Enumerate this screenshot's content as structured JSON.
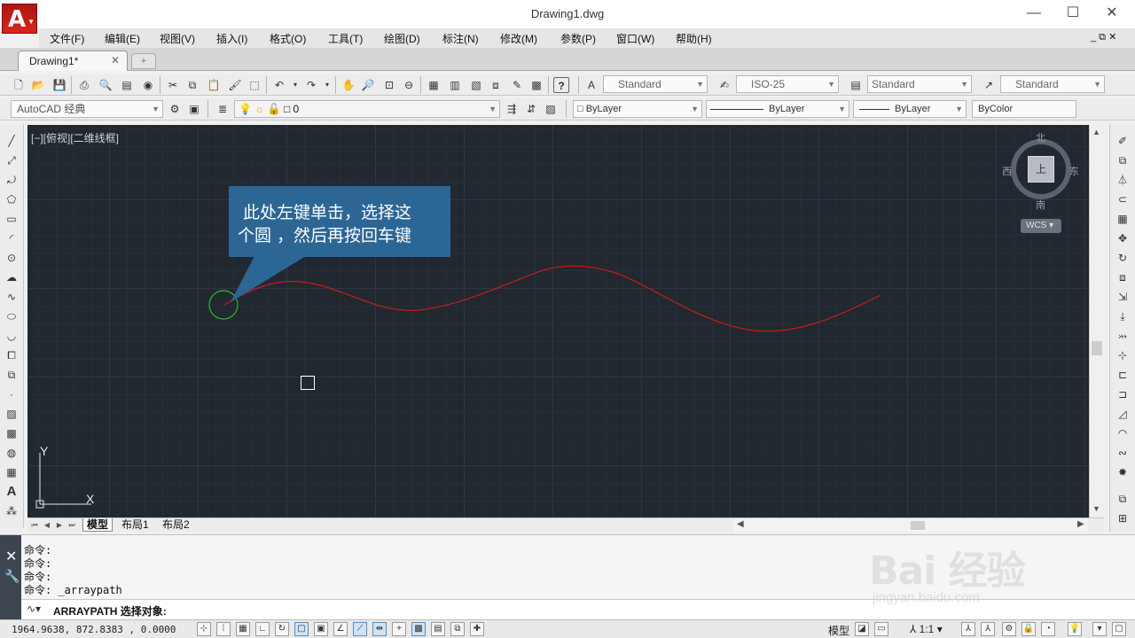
{
  "window": {
    "title": "Drawing1.dwg",
    "logo_letter": "A",
    "minimize": "—",
    "maximize": "☐",
    "close": "✕"
  },
  "menu": [
    "文件(F)",
    "编辑(E)",
    "视图(V)",
    "插入(I)",
    "格式(O)",
    "工具(T)",
    "绘图(D)",
    "标注(N)",
    "修改(M)",
    "参数(P)",
    "窗口(W)",
    "帮助(H)"
  ],
  "tabs": {
    "active": "Drawing1*",
    "close": "✕",
    "new_tab_icon": "+"
  },
  "styles_toolbar": {
    "text_style": "Standard",
    "dim_style": "ISO-25",
    "table_style": "Standard",
    "multileader_style": "Standard"
  },
  "layers_toolbar": {
    "workspace": "AutoCAD 经典",
    "current_layer": "0",
    "color": "ByLayer",
    "linetype": "ByLayer",
    "lineweight": "ByLayer",
    "plot_style": "ByColor"
  },
  "viewport": {
    "label": "[−][俯视][二维线框]",
    "viewcube_face": "上",
    "north": "北",
    "south": "南",
    "west": "西",
    "east": "东",
    "wcs": "WCS"
  },
  "drawing": {
    "spline_color": "#cc1a1a",
    "circle_color": "#22c02a",
    "canvas_color": "#212830"
  },
  "callout": {
    "line1": "此处左键单击，选择这",
    "line2": "个圆 ，然后再按回车键",
    "color": "#2c6695"
  },
  "ucs": {
    "x": "X",
    "y": "Y"
  },
  "layout_tabs": [
    "模型",
    "布局1",
    "布局2"
  ],
  "command_history": [
    "命令:",
    "命令:",
    "命令:",
    "命令: _arraypath"
  ],
  "command_input": "ARRAYPATH 选择对象:",
  "status": {
    "coords": "1964.9638, 872.8383 , 0.0000",
    "model_label": "模型",
    "annotation_scale": "1:1"
  },
  "watermark": {
    "main": "Bai 经验",
    "sub": "jingyan.baidu.com"
  }
}
